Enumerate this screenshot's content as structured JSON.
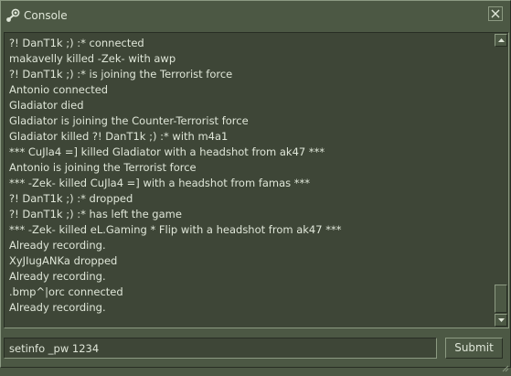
{
  "window": {
    "title": "Console",
    "icons": {
      "app": "steam-icon",
      "close": "close-icon"
    }
  },
  "log": {
    "lines": [
      "?! DanT1k ;) :* connected",
      "makavelly killed -Zek- with awp",
      "?! DanT1k ;) :* is joining the Terrorist force",
      "Antonio connected",
      "Gladiator died",
      "Gladiator is joining the Counter-Terrorist force",
      "Gladiator killed ?! DanT1k ;) :* with m4a1",
      "*** CuJla4 =] killed Gladiator with a headshot from ak47 ***",
      "Antonio is joining the Terrorist force",
      "*** -Zek- killed CuJla4 =] with a headshot from famas ***",
      "?! DanT1k ;) :* dropped",
      "?! DanT1k ;) :* has left the game",
      "*** -Zek- killed eL.Gaming * Flip with a headshot from ak47 ***",
      "Already recording.",
      "XyJIugANKa dropped",
      "Already recording.",
      ".bmp^|orc connected",
      "Already recording."
    ]
  },
  "command": {
    "value": "setinfo _pw 1234",
    "submit_label": "Submit"
  },
  "colors": {
    "panel": "#4c5844",
    "field": "#3e4637",
    "text": "#dfe6d8",
    "border_light": "#8c9a82",
    "border_dark": "#282e24"
  }
}
